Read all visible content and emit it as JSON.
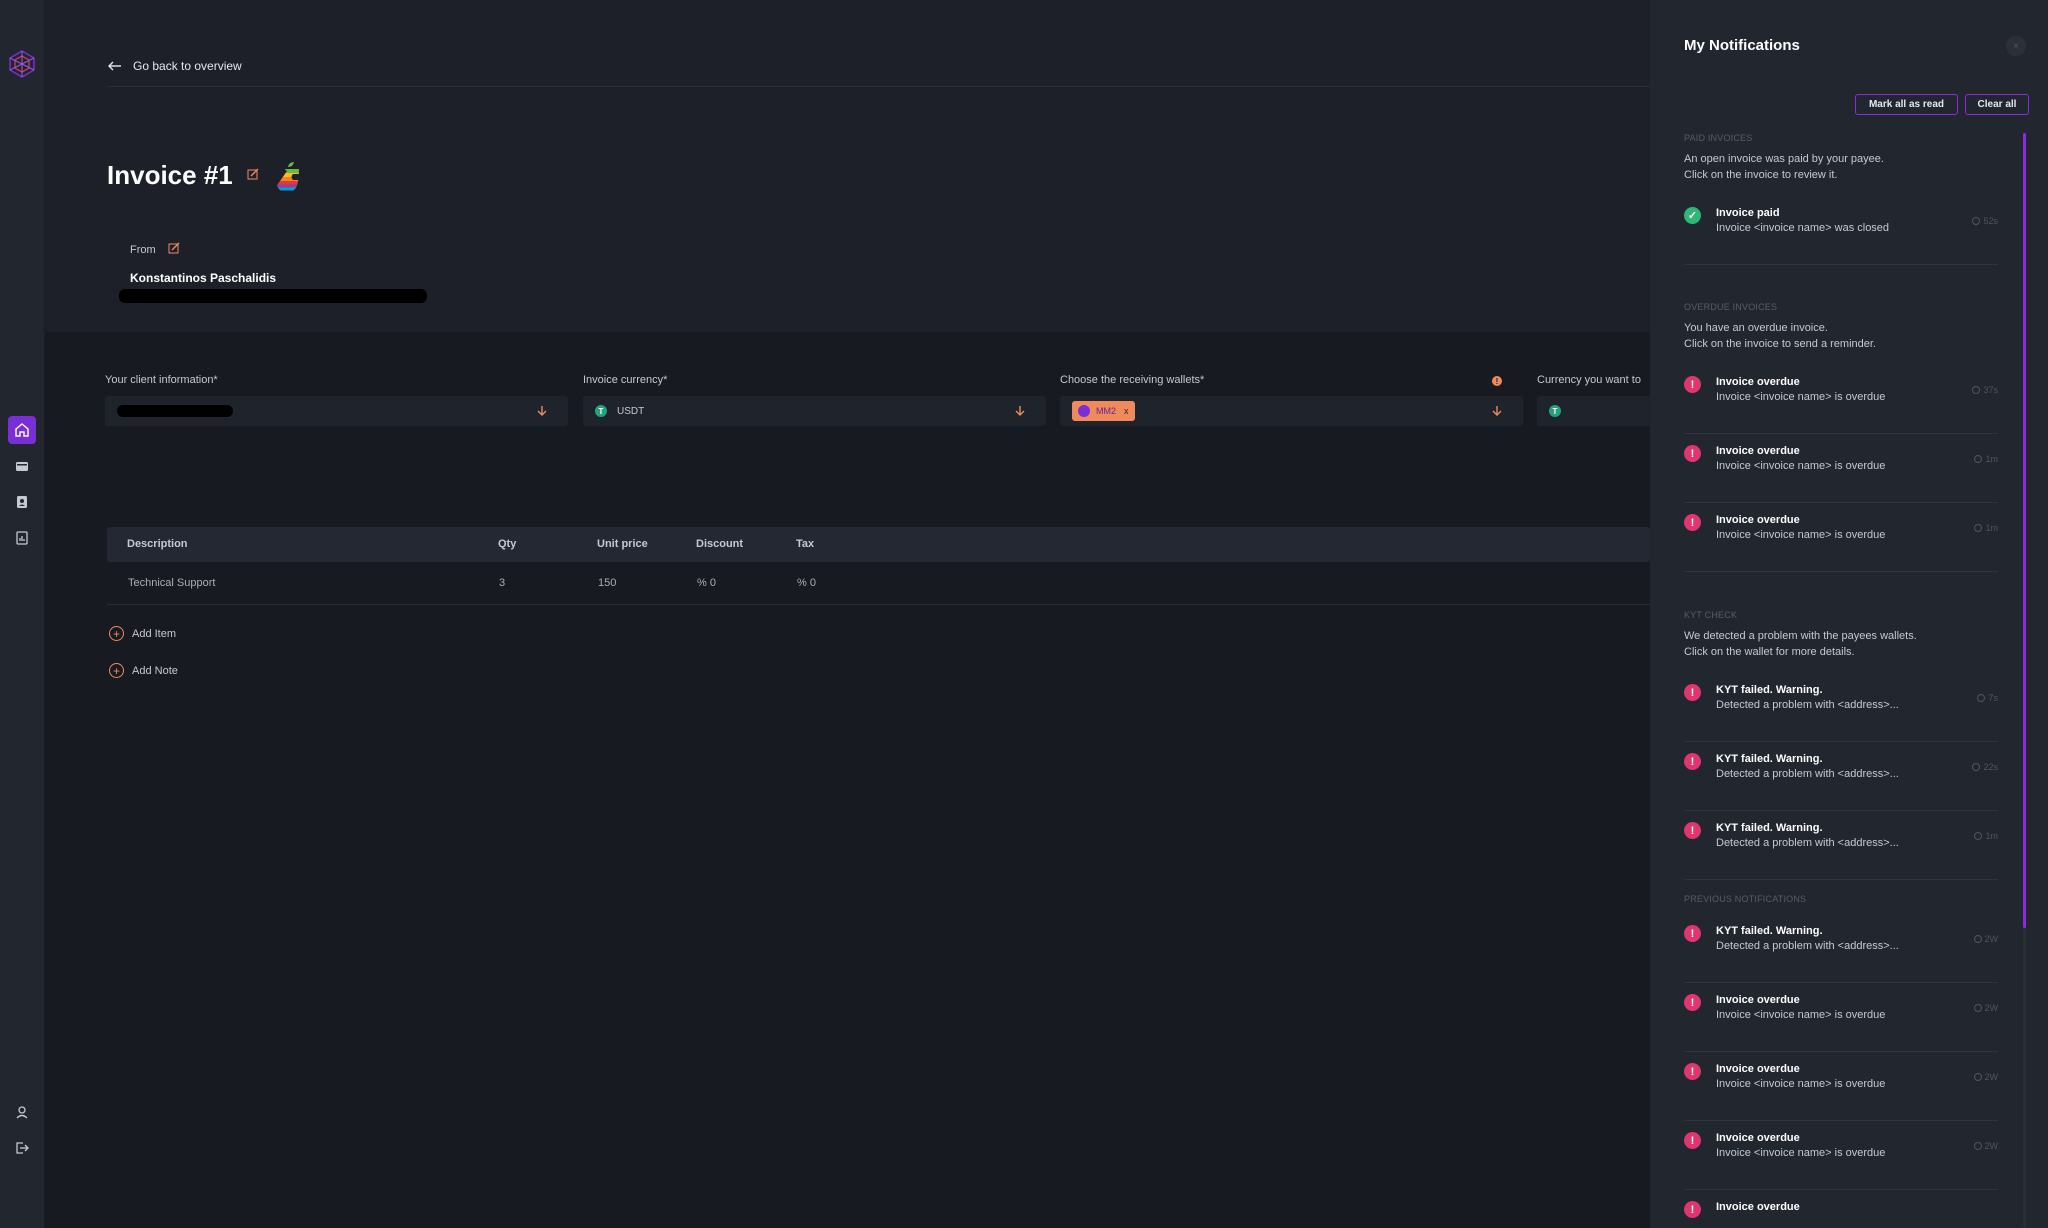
{
  "back_link": {
    "label": "Go back to overview"
  },
  "invoice": {
    "title": "Invoice #1"
  },
  "from": {
    "label": "From",
    "name": "Konstantinos Paschalidis"
  },
  "fields": {
    "client": {
      "label": "Your client information*"
    },
    "currency": {
      "label": "Invoice currency*",
      "value": "USDT"
    },
    "wallets": {
      "label": "Choose the receiving wallets*",
      "chip": "MM2",
      "chip_remove": "x"
    },
    "receive_currency": {
      "label": "Currency you want to"
    }
  },
  "table": {
    "headers": [
      "Description",
      "Qty",
      "Unit price",
      "Discount",
      "Tax"
    ],
    "rows": [
      {
        "description": "Technical Support",
        "qty": "3",
        "unit_price": "150",
        "discount": "% 0",
        "tax": "% 0"
      }
    ]
  },
  "actions": {
    "add_item": "Add Item",
    "add_note": "Add Note"
  },
  "notifications": {
    "title": "My Notifications",
    "mark_all_read": "Mark all as read",
    "clear_all": "Clear all",
    "sections": [
      {
        "title": "PAID INVOICES",
        "desc_line1": "An open invoice was paid by your payee.",
        "desc_line2": "Click on the invoice to review it.",
        "items": [
          {
            "type": "ok",
            "title": "Invoice paid",
            "sub": "Invoice <invoice name> was closed",
            "time": "52s"
          }
        ]
      },
      {
        "title": "OVERDUE INVOICES",
        "desc_line1": "You have an overdue invoice.",
        "desc_line2": "Click on the invoice to send a reminder.",
        "items": [
          {
            "type": "err",
            "title": "Invoice overdue",
            "sub": "Invoice <invoice name> is overdue",
            "time": "37s"
          },
          {
            "type": "err",
            "title": "Invoice overdue",
            "sub": "Invoice <invoice name> is overdue",
            "time": "1m"
          },
          {
            "type": "err",
            "title": "Invoice overdue",
            "sub": "Invoice <invoice name> is overdue",
            "time": "1m"
          }
        ]
      },
      {
        "title": "KYT CHECK",
        "desc_line1": "We detected a problem with the payees wallets.",
        "desc_line2": "Click on the wallet for more details.",
        "items": [
          {
            "type": "err",
            "title": "KYT failed. Warning.",
            "sub": "Detected a problem with <address>...",
            "time": "7s"
          },
          {
            "type": "err",
            "title": "KYT failed. Warning.",
            "sub": "Detected a problem with <address>...",
            "time": "22s"
          },
          {
            "type": "err",
            "title": "KYT failed. Warning.",
            "sub": "Detected a problem with <address>...",
            "time": "1m"
          }
        ]
      },
      {
        "title": "PREVIOUS NOTIFICATIONS",
        "items": [
          {
            "type": "err",
            "title": "KYT failed. Warning.",
            "sub": "Detected a problem with <address>...",
            "time": "2W"
          },
          {
            "type": "err",
            "title": "Invoice overdue",
            "sub": "Invoice <invoice name> is overdue",
            "time": "2W"
          },
          {
            "type": "err",
            "title": "Invoice overdue",
            "sub": "Invoice <invoice name> is overdue",
            "time": "2W"
          },
          {
            "type": "err",
            "title": "Invoice overdue",
            "sub": "Invoice <invoice name> is overdue",
            "time": "2W"
          },
          {
            "type": "err",
            "title": "Invoice overdue",
            "sub": "",
            "time": ""
          }
        ]
      }
    ]
  },
  "colors": {
    "accent": "#8a2be2",
    "active_nav": "#7a2ed6",
    "orange": "#f08a5d",
    "error": "#e0356d",
    "success": "#2eb877"
  },
  "icons": {
    "sidebar": [
      "app-logo-icon",
      "home-icon",
      "wallet-icon",
      "contacts-icon",
      "reports-icon",
      "settings-icon",
      "logout-icon"
    ]
  }
}
